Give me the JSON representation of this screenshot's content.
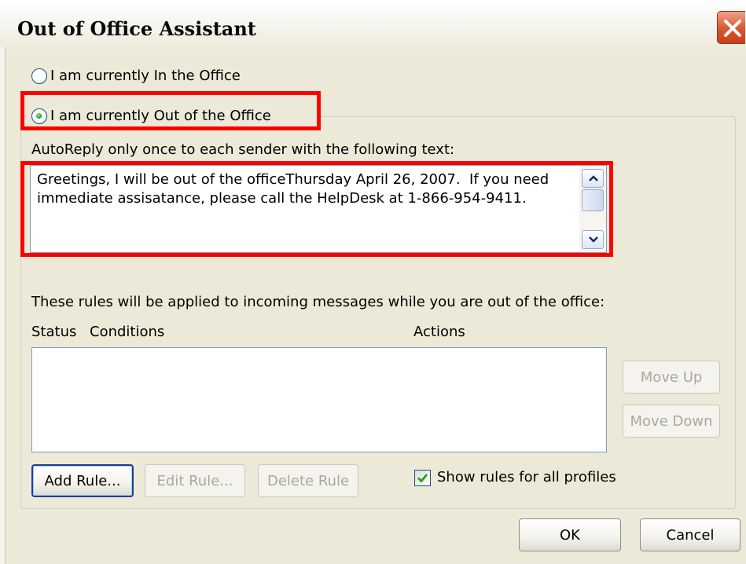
{
  "window": {
    "title": "Out of Office Assistant"
  },
  "status": {
    "in_office_label": "I am currently In the Office",
    "out_office_label": "I am currently Out of the Office",
    "selected": "out_of_office"
  },
  "autoreply": {
    "label": "AutoReply only once to each sender with the following text:",
    "text": "Greetings, I will be out of the officeThursday April 26, 2007.  If you need immediate assisatance, please call the HelpDesk at 1-866-954-9411."
  },
  "rules": {
    "description": "These rules will be applied to incoming messages while you are out of the office:",
    "columns": {
      "status": "Status",
      "conditions": "Conditions",
      "actions": "Actions"
    },
    "rows": [],
    "move_up_label": "Move Up",
    "move_down_label": "Move Down",
    "add_rule_label": "Add Rule...",
    "edit_rule_label": "Edit Rule...",
    "delete_rule_label": "Delete Rule",
    "show_all_profiles_label": "Show rules for all profiles",
    "show_all_profiles_checked": true
  },
  "footer": {
    "ok_label": "OK",
    "cancel_label": "Cancel"
  },
  "colors": {
    "highlight": "#ff0000",
    "dialog_background": "#ece9d8",
    "close_button": "#d8552f"
  }
}
